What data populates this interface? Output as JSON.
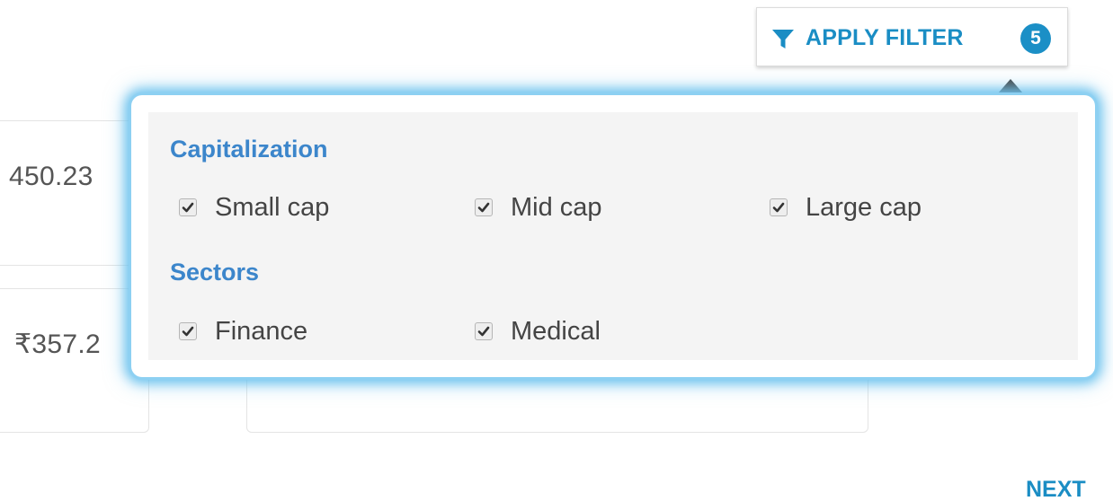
{
  "background": {
    "card_a_value": "450.23",
    "card_b_value": "₹357.2"
  },
  "apply_filter": {
    "label": "APPLY FILTER",
    "count": "5",
    "icon": "funnel-icon",
    "accent_color": "#1a8dc4"
  },
  "filter_popup": {
    "sections": [
      {
        "title": "Capitalization",
        "options": [
          {
            "label": "Small cap",
            "checked": true
          },
          {
            "label": "Mid cap",
            "checked": true
          },
          {
            "label": "Large cap",
            "checked": true
          }
        ]
      },
      {
        "title": "Sectors",
        "options": [
          {
            "label": "Finance",
            "checked": true
          },
          {
            "label": "Medical",
            "checked": true
          }
        ]
      }
    ],
    "title_color": "#3c86cb",
    "glow_color": "#6ec3ee"
  },
  "pagination": {
    "next_label": "NEXT"
  }
}
